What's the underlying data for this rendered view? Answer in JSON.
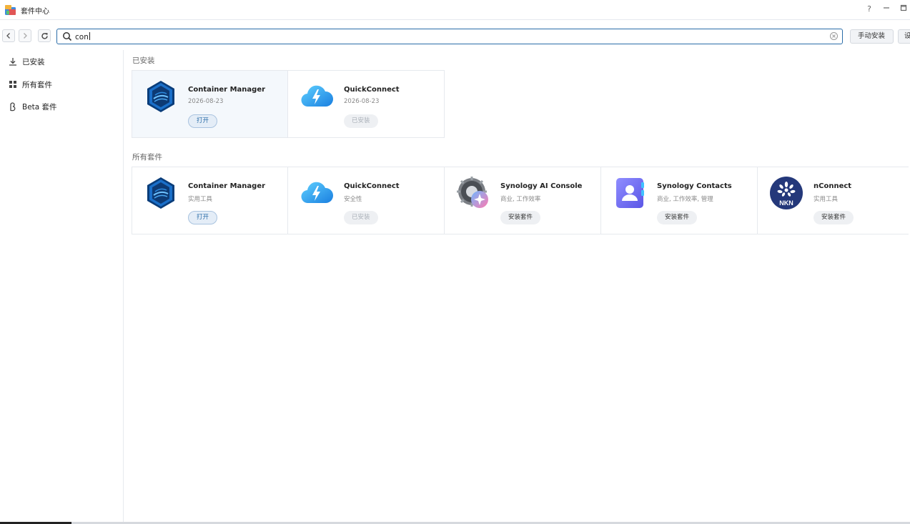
{
  "window": {
    "title": "套件中心",
    "help": "?",
    "minimize": "–",
    "maximize": "□"
  },
  "toolbar": {
    "search": {
      "value": "con",
      "placeholder": ""
    },
    "manual_install": "手动安装",
    "settings": "设置"
  },
  "sidebar": {
    "items": [
      {
        "label": "已安装",
        "icon": "download-icon"
      },
      {
        "label": "所有套件",
        "icon": "grid-icon"
      },
      {
        "label": "Beta 套件",
        "icon": "beta-icon"
      }
    ]
  },
  "installed": {
    "title": "已安装",
    "cards": [
      {
        "name": "Container Manager",
        "sub": "2026-08-23",
        "button": "打开",
        "button_style": "open",
        "icon": "container-manager-icon"
      },
      {
        "name": "QuickConnect",
        "sub": "2026-08-23",
        "button": "已安装",
        "button_style": "installed",
        "icon": "quickconnect-icon"
      }
    ]
  },
  "all": {
    "title": "所有套件",
    "cards": [
      {
        "name": "Container Manager",
        "sub": "实用工具",
        "button": "打开",
        "button_style": "open",
        "icon": "container-manager-icon"
      },
      {
        "name": "QuickConnect",
        "sub": "安全性",
        "button": "已安装",
        "button_style": "installed",
        "icon": "quickconnect-icon"
      },
      {
        "name": "Synology AI Console",
        "sub": "商业, 工作效率",
        "button": "安装套件",
        "button_style": "install",
        "icon": "ai-console-icon"
      },
      {
        "name": "Synology Contacts",
        "sub": "商业, 工作效率, 管理",
        "button": "安装套件",
        "button_style": "install",
        "icon": "contacts-icon"
      },
      {
        "name": "nConnect",
        "sub": "实用工具",
        "button": "安装套件",
        "button_style": "install",
        "icon": "nkn-icon",
        "icon_text": "NKN"
      }
    ]
  },
  "colors": {
    "accent": "#2a6ca8",
    "border": "#e6e9ee",
    "highlight": "#f4f8fc"
  }
}
